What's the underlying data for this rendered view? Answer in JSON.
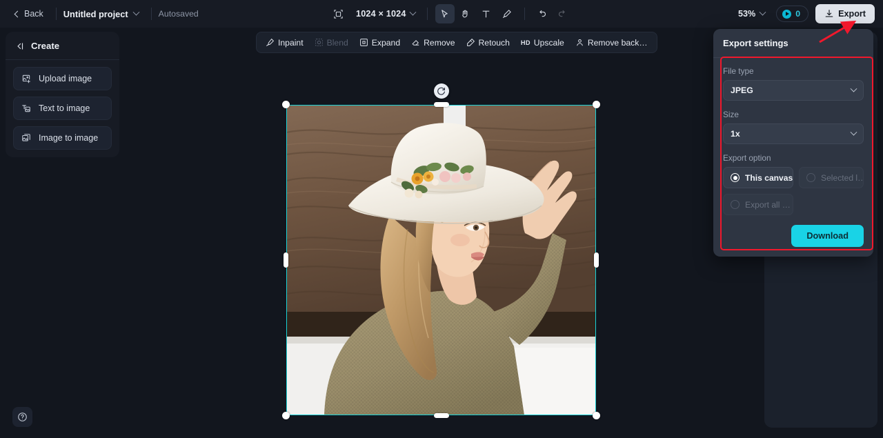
{
  "topbar": {
    "back_label": "Back",
    "project_name": "Untitled project",
    "autosave_status": "Autosaved",
    "canvas_dimensions": "1024 × 1024",
    "zoom_level": "53%",
    "credits_count": "0",
    "export_label": "Export",
    "tools": [
      {
        "name": "resize-canvas-icon",
        "label": "Resize canvas",
        "active": false
      },
      {
        "name": "select-tool",
        "label": "Select",
        "active": true
      },
      {
        "name": "hand-tool",
        "label": "Hand",
        "active": false
      },
      {
        "name": "text-tool",
        "label": "Text",
        "active": false
      },
      {
        "name": "brush-tool",
        "label": "Brush",
        "active": false
      },
      {
        "name": "undo-button",
        "label": "Undo",
        "active": false
      },
      {
        "name": "redo-button",
        "label": "Redo",
        "active": false
      }
    ]
  },
  "create_panel": {
    "title": "Create",
    "items": [
      {
        "label": "Upload image",
        "icon": "upload-image-icon"
      },
      {
        "label": "Text to image",
        "icon": "text-to-image-icon"
      },
      {
        "label": "Image to image",
        "icon": "image-to-image-icon"
      }
    ]
  },
  "float_toolbar": {
    "items": [
      {
        "label": "Inpaint",
        "icon": "inpaint-icon",
        "disabled": false
      },
      {
        "label": "Blend",
        "icon": "blend-icon",
        "disabled": true
      },
      {
        "label": "Expand",
        "icon": "expand-icon",
        "disabled": false
      },
      {
        "label": "Remove",
        "icon": "remove-icon",
        "disabled": false
      },
      {
        "label": "Retouch",
        "icon": "retouch-icon",
        "disabled": false
      },
      {
        "label": "Upscale",
        "icon": "upscale-icon",
        "badge": "HD",
        "disabled": false
      },
      {
        "label": "Remove back…",
        "icon": "remove-background-icon",
        "disabled": false
      }
    ]
  },
  "canvas": {
    "selection_color": "#19d3d8",
    "image_alt": "Woman in white wide-brim hat with floral band, olive waffle-knit sweater, wooden backdrop"
  },
  "export_panel": {
    "title": "Export settings",
    "file_type_label": "File type",
    "file_type_value": "JPEG",
    "size_label": "Size",
    "size_value": "1x",
    "export_option_label": "Export option",
    "options": [
      {
        "label": "This canvas",
        "selected": true,
        "disabled": false
      },
      {
        "label": "Selected l…",
        "selected": false,
        "disabled": true
      },
      {
        "label": "Export all …",
        "selected": false,
        "disabled": true
      }
    ],
    "download_label": "Download",
    "accent_color": "#19d3e6",
    "annotation_color": "#f1182c"
  },
  "help": {
    "label": "Help"
  }
}
